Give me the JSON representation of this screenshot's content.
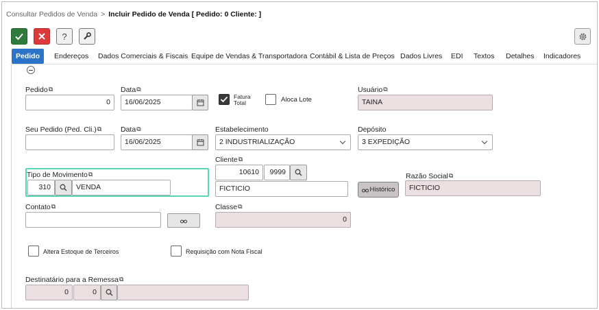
{
  "breadcrumb": {
    "parent": "Consultar Pedidos de Venda",
    "separator": ">",
    "current": "Incluir Pedido de Venda [ Pedido: 0 Cliente: ]"
  },
  "toolbar": {
    "help_label": "?"
  },
  "tabs": [
    "Pedido",
    "Endereços",
    "Dados Comerciais & Fiscais",
    "Equipe de Vendas & Transportadora",
    "Contábil & Lista de Preços",
    "Dados Livres",
    "EDI",
    "Textos",
    "Detalhes",
    "Indicadores"
  ],
  "form": {
    "pedido": {
      "label": "Pedido",
      "value": "0"
    },
    "data1": {
      "label": "Data",
      "value": "16/06/2025"
    },
    "fatura_total": {
      "label": "Fatura Total",
      "checked": true
    },
    "aloca_lote": {
      "label": "Aloca Lote",
      "checked": false
    },
    "usuario": {
      "label": "Usuário",
      "value": "TAINA"
    },
    "seu_pedido": {
      "label": "Seu Pedido (Ped. Cli.)",
      "value": ""
    },
    "data2": {
      "label": "Data",
      "value": "16/06/2025"
    },
    "estabelecimento": {
      "label": "Estabelecimento",
      "value": "2 INDUSTRIALIZAÇÃO"
    },
    "deposito": {
      "label": "Depósito",
      "value": "3 EXPEDIÇÃO"
    },
    "cliente": {
      "label": "Cliente",
      "code": "10610",
      "sub": "9999",
      "name": "FICTICIO"
    },
    "tipo_movimento": {
      "label": "Tipo de Movimento",
      "code": "310",
      "desc": "VENDA"
    },
    "historico_label": "Histórico",
    "razao_social": {
      "label": "Razão Social",
      "value": "FICTICIO"
    },
    "contato": {
      "label": "Contato",
      "value": ""
    },
    "classe": {
      "label": "Classe",
      "value": "0"
    },
    "altera_estoque": {
      "label": "Altera Estoque de Terceiros",
      "checked": false
    },
    "requisicao": {
      "label": "Requisição com Nota Fiscal",
      "checked": false
    },
    "destinatario": {
      "label": "Destinatário para a Remessa",
      "val1": "0",
      "val2": "0",
      "desc": ""
    }
  },
  "colors": {
    "accent": "#2b74c8",
    "ok": "#2f7a3c",
    "cancel": "#dc3a3a",
    "focus": "#56d6b6",
    "readonly_bg": "#ecdfe1"
  },
  "icons": [
    "check-icon",
    "close-icon",
    "wrench-icon",
    "gear-icon",
    "copy-icon",
    "calendar-icon",
    "search-icon",
    "chevron-down-icon",
    "binoculars-icon"
  ]
}
